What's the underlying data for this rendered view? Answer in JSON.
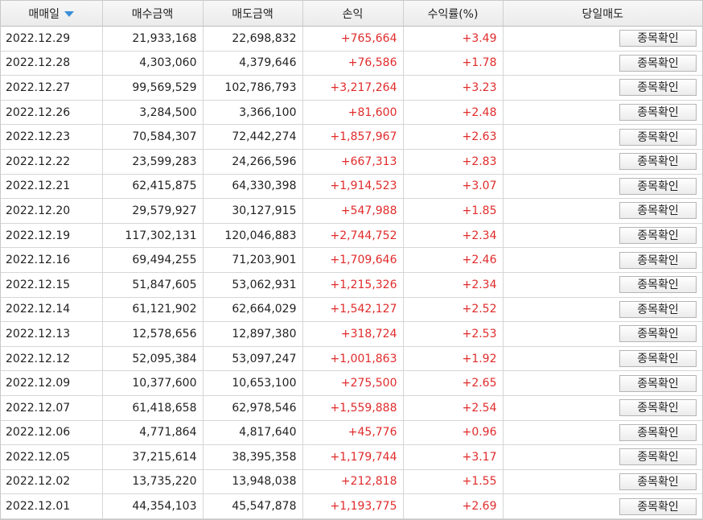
{
  "colors": {
    "positive": "#e02b2b",
    "sort_icon": "#3a8fd8"
  },
  "headers": {
    "date": "매매일",
    "date_sort_icon": "sort-desc-icon",
    "buy": "매수금액",
    "sell": "매도금액",
    "pl": "손익",
    "rate": "수익률(%)",
    "action": "당일매도"
  },
  "button_label": "종목확인",
  "rows": [
    {
      "date": "2022.12.29",
      "buy": "21,933,168",
      "sell": "22,698,832",
      "pl": "+765,664",
      "rate": "+3.49"
    },
    {
      "date": "2022.12.28",
      "buy": "4,303,060",
      "sell": "4,379,646",
      "pl": "+76,586",
      "rate": "+1.78"
    },
    {
      "date": "2022.12.27",
      "buy": "99,569,529",
      "sell": "102,786,793",
      "pl": "+3,217,264",
      "rate": "+3.23"
    },
    {
      "date": "2022.12.26",
      "buy": "3,284,500",
      "sell": "3,366,100",
      "pl": "+81,600",
      "rate": "+2.48"
    },
    {
      "date": "2022.12.23",
      "buy": "70,584,307",
      "sell": "72,442,274",
      "pl": "+1,857,967",
      "rate": "+2.63"
    },
    {
      "date": "2022.12.22",
      "buy": "23,599,283",
      "sell": "24,266,596",
      "pl": "+667,313",
      "rate": "+2.83"
    },
    {
      "date": "2022.12.21",
      "buy": "62,415,875",
      "sell": "64,330,398",
      "pl": "+1,914,523",
      "rate": "+3.07"
    },
    {
      "date": "2022.12.20",
      "buy": "29,579,927",
      "sell": "30,127,915",
      "pl": "+547,988",
      "rate": "+1.85"
    },
    {
      "date": "2022.12.19",
      "buy": "117,302,131",
      "sell": "120,046,883",
      "pl": "+2,744,752",
      "rate": "+2.34"
    },
    {
      "date": "2022.12.16",
      "buy": "69,494,255",
      "sell": "71,203,901",
      "pl": "+1,709,646",
      "rate": "+2.46"
    },
    {
      "date": "2022.12.15",
      "buy": "51,847,605",
      "sell": "53,062,931",
      "pl": "+1,215,326",
      "rate": "+2.34"
    },
    {
      "date": "2022.12.14",
      "buy": "61,121,902",
      "sell": "62,664,029",
      "pl": "+1,542,127",
      "rate": "+2.52"
    },
    {
      "date": "2022.12.13",
      "buy": "12,578,656",
      "sell": "12,897,380",
      "pl": "+318,724",
      "rate": "+2.53"
    },
    {
      "date": "2022.12.12",
      "buy": "52,095,384",
      "sell": "53,097,247",
      "pl": "+1,001,863",
      "rate": "+1.92"
    },
    {
      "date": "2022.12.09",
      "buy": "10,377,600",
      "sell": "10,653,100",
      "pl": "+275,500",
      "rate": "+2.65"
    },
    {
      "date": "2022.12.07",
      "buy": "61,418,658",
      "sell": "62,978,546",
      "pl": "+1,559,888",
      "rate": "+2.54"
    },
    {
      "date": "2022.12.06",
      "buy": "4,771,864",
      "sell": "4,817,640",
      "pl": "+45,776",
      "rate": "+0.96"
    },
    {
      "date": "2022.12.05",
      "buy": "37,215,614",
      "sell": "38,395,358",
      "pl": "+1,179,744",
      "rate": "+3.17"
    },
    {
      "date": "2022.12.02",
      "buy": "13,735,220",
      "sell": "13,948,038",
      "pl": "+212,818",
      "rate": "+1.55"
    },
    {
      "date": "2022.12.01",
      "buy": "44,354,103",
      "sell": "45,547,878",
      "pl": "+1,193,775",
      "rate": "+2.69"
    }
  ]
}
